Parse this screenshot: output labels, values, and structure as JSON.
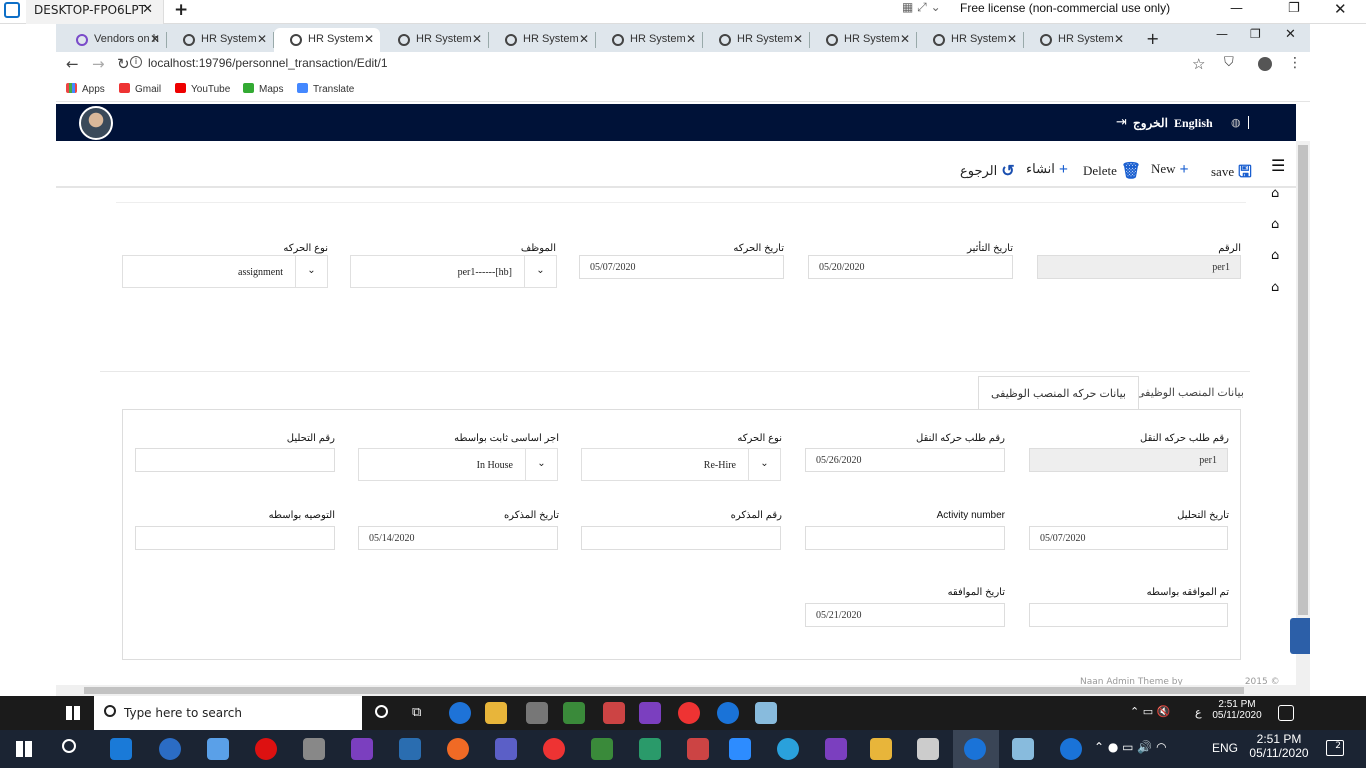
{
  "outer": {
    "tab_title": "DESKTOP-FPO6LPT",
    "license": "Free license (non-commercial use only)"
  },
  "browser": {
    "tabs": [
      {
        "label": "Vendors on h"
      },
      {
        "label": "HR System"
      },
      {
        "label": "HR System"
      },
      {
        "label": "HR System"
      },
      {
        "label": "HR System"
      },
      {
        "label": "HR System"
      },
      {
        "label": "HR System"
      },
      {
        "label": "HR System"
      },
      {
        "label": "HR System"
      },
      {
        "label": "HR System"
      }
    ],
    "url": "localhost:19796/personnel_transaction/Edit/1",
    "bookmarks": [
      "Apps",
      "Gmail",
      "YouTube",
      "Maps",
      "Translate"
    ]
  },
  "header": {
    "logout": "الخروج",
    "language": "English"
  },
  "toolbar": {
    "save": "save",
    "new": "New",
    "delete": "Delete",
    "create": "انشاء",
    "back": "الرجوع"
  },
  "form": {
    "number_label": "الرقم",
    "number_value": "per1",
    "effect_date_label": "تاريخ التأثير",
    "effect_date_value": "05/20/2020",
    "move_date_label": "تاريخ الحركه",
    "move_date_value": "05/07/2020",
    "employee_label": "الموظف",
    "employee_value": "per1------[hb]",
    "move_type_label": "نوع الحركه",
    "move_type_value": "assignment"
  },
  "tabs": {
    "tab1": "بيانات المنصب الوظيفى",
    "tab2": "بيانات حركه المنصب الوظيفى"
  },
  "detail": {
    "req_no_label": "رقم طلب حركه النقل",
    "req_no_value": "per1",
    "req_no2_label": "رقم طلب حركه النقل",
    "req_no2_value": "05/26/2020",
    "move_type_label": "نوع الحركه",
    "move_type_value": "Re-Hire",
    "basic_pay_label": "اجر اساسى ثابت بواسطه",
    "basic_pay_value": "In House",
    "analysis_no_label": "رقم التحليل",
    "analysis_no_value": "",
    "analysis_date_label": "تاريخ التحليل",
    "analysis_date_value": "05/07/2020",
    "activity_label": "Activity number",
    "activity_value": "",
    "memo_no_label": "رقم المذكره",
    "memo_no_value": "",
    "memo_date_label": "تاريخ المذكره",
    "memo_date_value": "05/14/2020",
    "recommend_label": "التوصيه بواسطه",
    "recommend_value": "",
    "approved_by_label": "تم الموافقه بواسطه",
    "approved_by_value": "",
    "approval_date_label": "تاريخ الموافقه",
    "approval_date_value": "05/21/2020"
  },
  "footer": {
    "text": "Naan Admin Theme by",
    "year": "2015 ©"
  },
  "taskbar": {
    "search_placeholder": "Type here to search",
    "remote_time": "2:51 PM",
    "remote_date": "05/11/2020",
    "remote_lang": "ع",
    "time": "2:51 PM",
    "date": "05/11/2020",
    "lang": "ENG",
    "notifications": "2"
  }
}
